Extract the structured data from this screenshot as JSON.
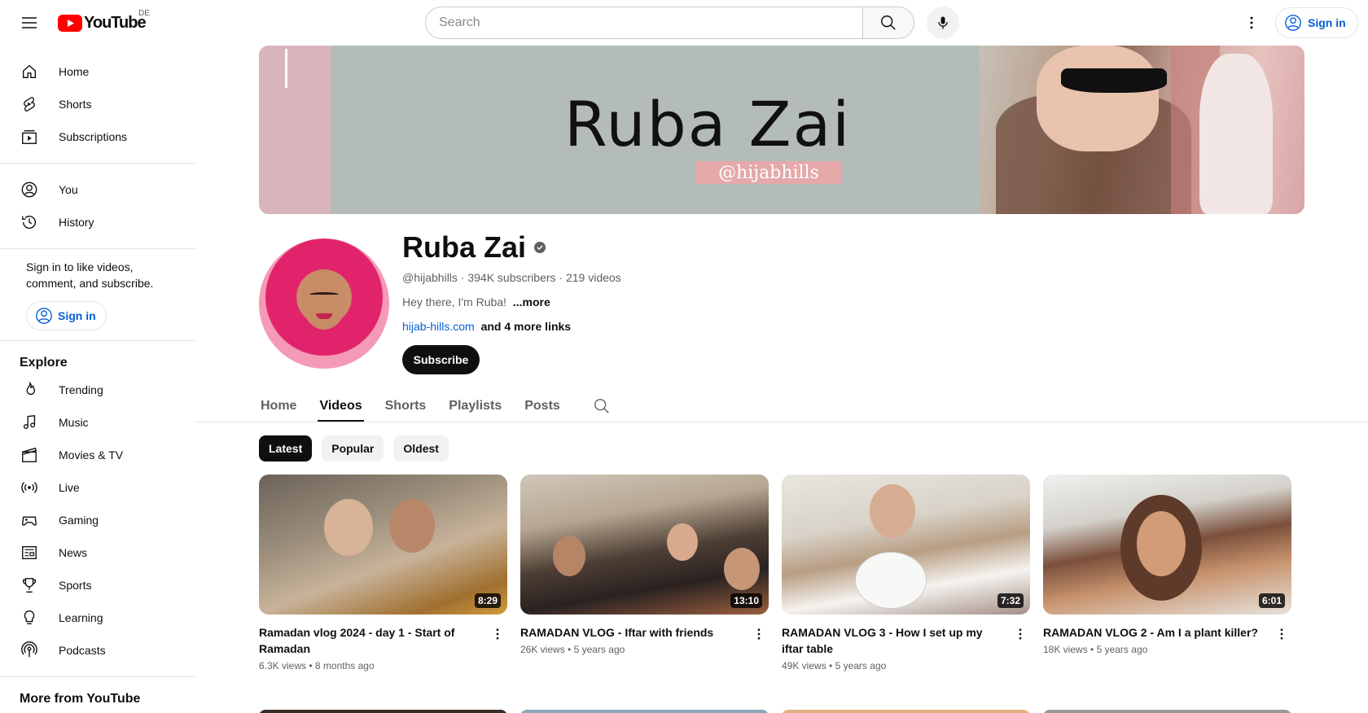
{
  "header": {
    "logo_text": "YouTube",
    "region": "DE",
    "search_placeholder": "Search",
    "sign_in": "Sign in"
  },
  "sidebar": {
    "primary": [
      {
        "label": "Home",
        "icon": "home-icon"
      },
      {
        "label": "Shorts",
        "icon": "shorts-icon"
      },
      {
        "label": "Subscriptions",
        "icon": "subscriptions-icon"
      }
    ],
    "you": [
      {
        "label": "You",
        "icon": "you-icon"
      },
      {
        "label": "History",
        "icon": "history-icon"
      }
    ],
    "signin_message": "Sign in to like videos, comment, and subscribe.",
    "signin_button": "Sign in",
    "explore_heading": "Explore",
    "explore": [
      {
        "label": "Trending",
        "icon": "trending-icon"
      },
      {
        "label": "Music",
        "icon": "music-icon"
      },
      {
        "label": "Movies & TV",
        "icon": "movies-icon"
      },
      {
        "label": "Live",
        "icon": "live-icon"
      },
      {
        "label": "Gaming",
        "icon": "gaming-icon"
      },
      {
        "label": "News",
        "icon": "news-icon"
      },
      {
        "label": "Sports",
        "icon": "sports-icon"
      },
      {
        "label": "Learning",
        "icon": "learning-icon"
      },
      {
        "label": "Podcasts",
        "icon": "podcasts-icon"
      }
    ],
    "more_heading": "More from YouTube"
  },
  "banner": {
    "title": "Ruba Zai",
    "handle": "@hijabhills"
  },
  "channel": {
    "name": "Ruba Zai",
    "meta": "@hijabhills · 394K subscribers · 219 videos",
    "description": "Hey there, I'm Ruba!",
    "more": "...more",
    "link": "hijab-hills.com",
    "more_links": "and 4 more links",
    "subscribe": "Subscribe"
  },
  "tabs": [
    "Home",
    "Videos",
    "Shorts",
    "Playlists",
    "Posts"
  ],
  "active_tab": "Videos",
  "chips": [
    "Latest",
    "Popular",
    "Oldest"
  ],
  "active_chip": "Latest",
  "videos": [
    {
      "title": "Ramadan vlog 2024 - day 1 - Start of Ramadan",
      "duration": "8:29",
      "views": "6.3K views",
      "age": "8 months ago"
    },
    {
      "title": "RAMADAN VLOG - Iftar with friends",
      "duration": "13:10",
      "views": "26K views",
      "age": "5 years ago"
    },
    {
      "title": "RAMADAN VLOG 3 - How I set up my iftar table",
      "duration": "7:32",
      "views": "49K views",
      "age": "5 years ago"
    },
    {
      "title": "RAMADAN VLOG 2 - Am I a plant killer?",
      "duration": "6:01",
      "views": "18K views",
      "age": "5 years ago"
    }
  ],
  "colors": {
    "brand_red": "#ff0000",
    "link_blue": "#065fd4",
    "text_primary": "#0f0f0f",
    "text_secondary": "#606060"
  }
}
